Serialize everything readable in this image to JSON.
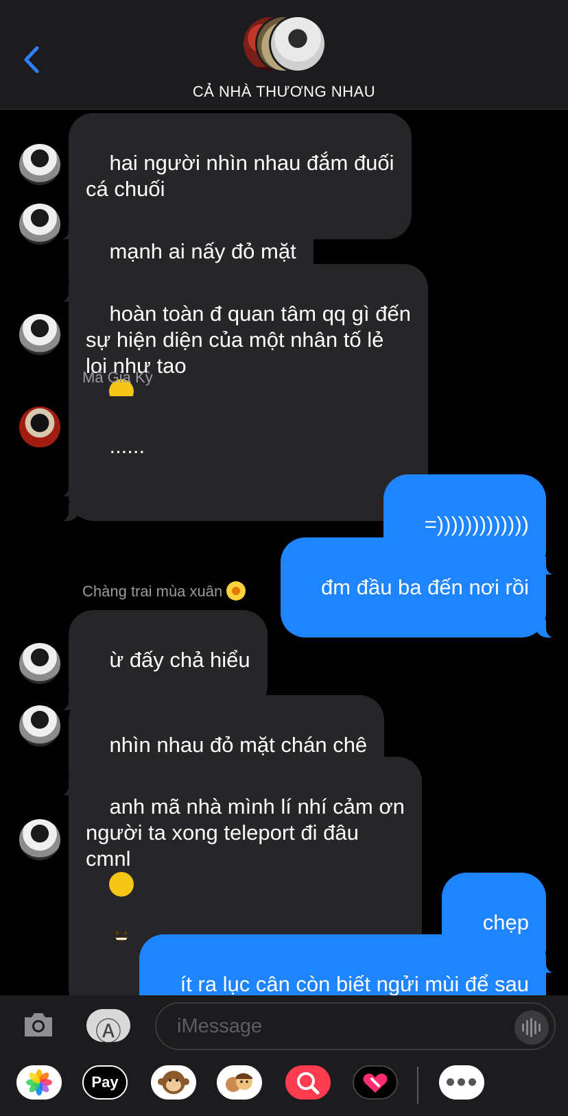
{
  "header": {
    "title": "CẢ NHÀ THƯƠNG NHAU",
    "back_icon": "chevron-left-icon",
    "accent_color": "#1f84ff"
  },
  "messages": [
    {
      "direction": "in",
      "text": "hai người nhìn nhau đắm đuối\ncá chuối"
    },
    {
      "direction": "in",
      "text": "mạnh ai nấy đỏ mặt"
    },
    {
      "direction": "in",
      "text": "hoàn toàn đ quan tâm qq gì đến\nsự hiện diện của một nhân tố lẻ\nloi như tao",
      "emoji": "slightly-smiling-face"
    },
    {
      "direction": "in",
      "sender": "Mã Gia Kỳ",
      "text": "......"
    },
    {
      "direction": "out",
      "text": "=)))))))))))))"
    },
    {
      "direction": "out",
      "text": "đm đầu ba đến nơi rồi"
    },
    {
      "direction": "in",
      "sender": "Chàng trai mùa xuân",
      "sender_emoji": "sunflower",
      "text": "ừ đấy chả hiểu"
    },
    {
      "direction": "in",
      "text": "nhìn nhau đỏ mặt chán chê"
    },
    {
      "direction": "in",
      "text": "anh mã nhà mình lí nhí cảm ơn\nngười ta xong teleport đi đâu\ncmnl",
      "emoji": "grinning-face"
    },
    {
      "direction": "out",
      "text": "chẹp"
    },
    {
      "direction": "out",
      "text": "ít ra lục cân còn biết ngửi mùi để sau\nnày nhớ nhau"
    }
  ],
  "composer": {
    "placeholder": "iMessage",
    "camera_icon": "camera-icon",
    "appstore_icon": "app-store-icon",
    "voice_icon": "waveform-icon"
  },
  "app_drawer": {
    "apple_pay_label": " Pay",
    "apps": [
      "photos-icon",
      "apple-pay-icon",
      "monkey-memoji-icon",
      "memoji-stickers-icon",
      "image-search-icon",
      "digital-touch-icon",
      "more-icon"
    ]
  }
}
